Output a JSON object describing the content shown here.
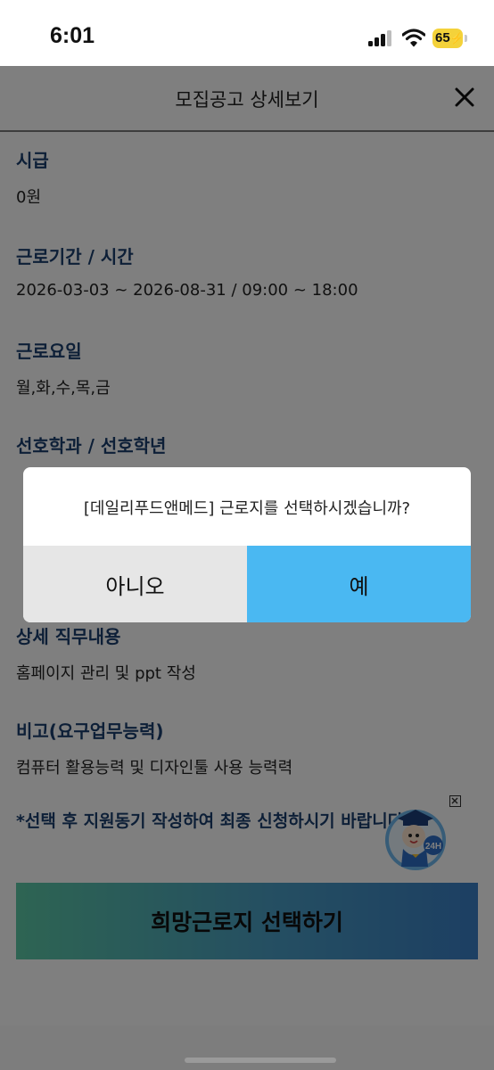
{
  "status_bar": {
    "time": "6:01",
    "battery_level": "65",
    "battery_color": "#f4d23a"
  },
  "header": {
    "title": "모집공고 상세보기",
    "close_icon": "close-icon"
  },
  "details": [
    {
      "label": "시급",
      "value": "0원"
    },
    {
      "label": "근로기간 / 시간",
      "value": "2026-03-03 ~ 2026-08-31 / 09:00 ~ 18:00"
    },
    {
      "label": "근로요일",
      "value": "월,화,수,목,금"
    },
    {
      "label": "선호학과 / 선호학년",
      "value": ""
    },
    {
      "label": "상세 직무내용",
      "value": "홈페이지 관리 및 ppt 작성"
    },
    {
      "label": "비고(요구업무능력)",
      "value": "컴퓨터 활용능력 및 디자인툴 사용 능력력"
    }
  ],
  "notice": "*선택 후 지원동기 작성하여 최종 신청하시기 바랍니다.",
  "apply_button": "희망근로지 선택하기",
  "chatbot": {
    "badge": "24H",
    "icon": "chatbot-mascot-icon"
  },
  "dialog": {
    "message": "[데일리푸드앤메드] 근로지를 선택하시겠습니까?",
    "no_label": "아니오",
    "yes_label": "예",
    "yes_color": "#4ab8f2"
  }
}
